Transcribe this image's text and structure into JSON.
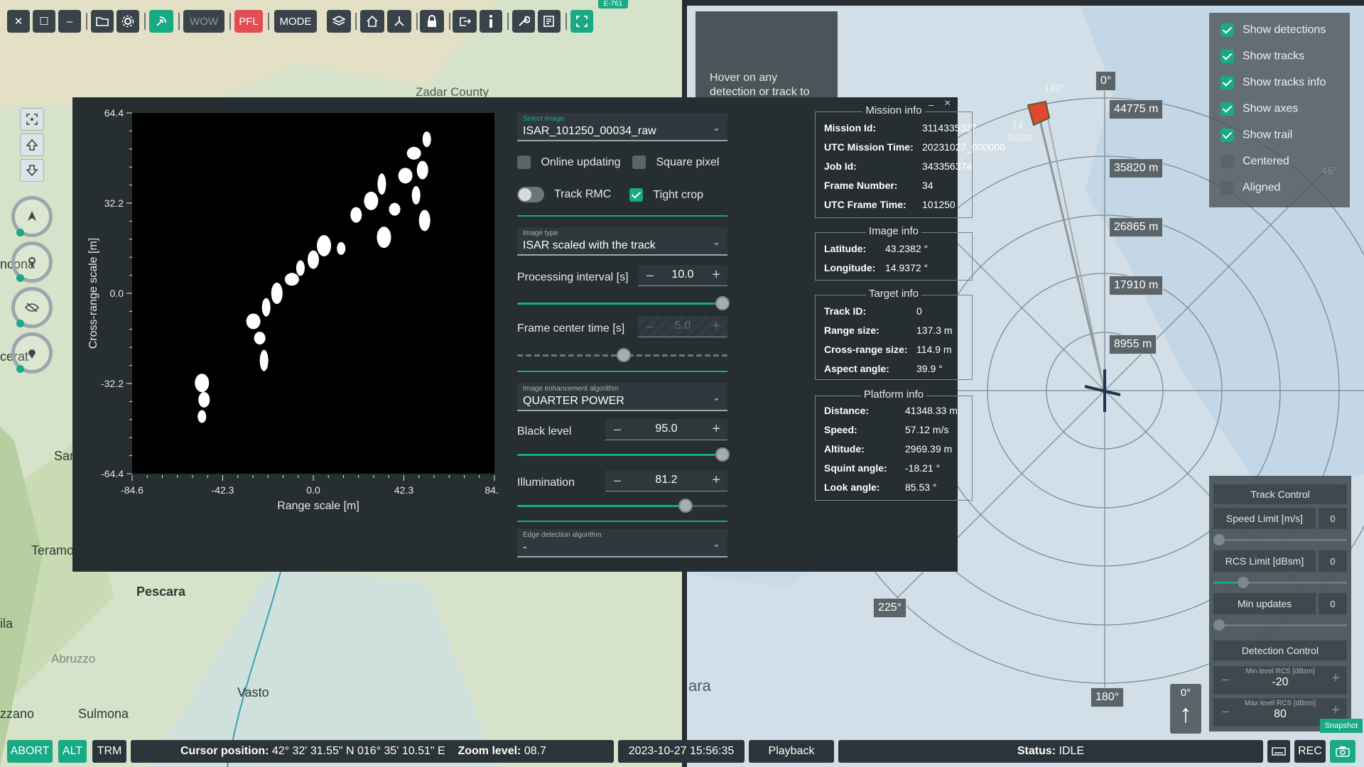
{
  "toolbar": {
    "close": "✕",
    "maximize": "☐",
    "minimize": "–",
    "wow_label": "WOW",
    "pfl_label": "PFL",
    "mode_label": "MODE",
    "map_badge": "E-761"
  },
  "map_left": {
    "labels": [
      "Zadar County",
      "ncona",
      "cerat",
      "Sar",
      "Teramo",
      "Pescara",
      "ila",
      "Abruzzo",
      "Vasto",
      "zzano",
      "Sulmona"
    ]
  },
  "image_panel": {
    "y_axis_label": "Cross-range scale [m]",
    "x_axis_label": "Range scale [m]",
    "y_ticks": [
      "64.4",
      "32.2",
      "0.0",
      "-32.2",
      "-64.4"
    ],
    "x_ticks": [
      "-84.6",
      "-42.3",
      "0.0",
      "42.3",
      "84.6"
    ]
  },
  "controls": {
    "select_image_label": "Select image",
    "select_image_value": "ISAR_101250_00034_raw",
    "online_updating": "Online updating",
    "square_pixel": "Square pixel",
    "track_rmc": "Track RMC",
    "tight_crop": "Tight crop",
    "image_type_label": "Image type",
    "image_type_value": "ISAR scaled with the track",
    "processing_interval_label": "Processing interval [s]",
    "processing_interval_value": "10.0",
    "frame_center_label": "Frame center time [s]",
    "frame_center_value": "5.0",
    "enhancement_label": "Image enhancement algorithm",
    "enhancement_value": "QUARTER POWER",
    "black_level_label": "Black level",
    "black_level_value": "95.0",
    "illumination_label": "Illumination",
    "illumination_value": "81.2",
    "edge_label": "Edge detection algorithm",
    "edge_value": "-",
    "minus": "–",
    "plus": "+",
    "chevron": "⌄",
    "panel_minimize": "–",
    "panel_close": "×"
  },
  "mission_info": {
    "title": "Mission info",
    "rows": [
      {
        "k": "Mission Id:",
        "v": "3114335327"
      },
      {
        "k": "UTC Mission Time:",
        "v": "20231027_000000"
      },
      {
        "k": "Job Id:",
        "v": "343356374"
      },
      {
        "k": "Frame Number:",
        "v": "34"
      },
      {
        "k": "UTC Frame Time:",
        "v": "101250"
      }
    ]
  },
  "image_info": {
    "title": "Image info",
    "rows": [
      {
        "k": "Latitude:",
        "v": "43.2382 °"
      },
      {
        "k": "Longitude:",
        "v": "14.9372 °"
      }
    ]
  },
  "target_info": {
    "title": "Target info",
    "rows": [
      {
        "k": "Track ID:",
        "v": "0"
      },
      {
        "k": "Range size:",
        "v": "137.3 m"
      },
      {
        "k": "Cross-range size:",
        "v": "114.9 m"
      },
      {
        "k": "Aspect angle:",
        "v": "39.9 °"
      }
    ]
  },
  "platform_info": {
    "title": "Platform info",
    "rows": [
      {
        "k": "Distance:",
        "v": "41348.33 m"
      },
      {
        "k": "Speed:",
        "v": "57.12 m/s"
      },
      {
        "k": "Altitude:",
        "v": "2969.39 m"
      },
      {
        "k": "Squint angle:",
        "v": "-18.21 °"
      },
      {
        "k": "Look angle:",
        "v": "85.53 °"
      }
    ]
  },
  "hover_box": {
    "text1": "Hover on any",
    "text2": "detection or track to"
  },
  "overlay_options": {
    "items": [
      {
        "label": "Show detections",
        "checked": true
      },
      {
        "label": "Show tracks",
        "checked": true
      },
      {
        "label": "Show tracks info",
        "checked": true
      },
      {
        "label": "Show axes",
        "checked": true
      },
      {
        "label": "Show trail",
        "checked": true
      },
      {
        "label": "Centered",
        "checked": false
      },
      {
        "label": "Aligned",
        "checked": false
      }
    ],
    "faint_angle": "45°"
  },
  "radar": {
    "ranges": [
      "44775 m",
      "35820 m",
      "26865 m",
      "17910 m",
      "8955 m"
    ],
    "angles": {
      "top": "0°",
      "bottom": "180°",
      "left": "225°",
      "track": "140°"
    },
    "track_label_1": "14",
    "track_label_2": "R026",
    "map_text": "ara",
    "north_label": "0°",
    "north_arrow": "↑"
  },
  "track_control": {
    "title": "Track Control",
    "speed_limit_label": "Speed Limit [m/s]",
    "speed_limit_value": "0",
    "rcs_limit_label": "RCS Limit [dBsm]",
    "rcs_limit_value": "0",
    "min_updates_label": "Min updates",
    "min_updates_value": "0",
    "detection_title": "Detection Control",
    "min_rcs_label": "Min level RCS [dBsm]",
    "min_rcs_value": "-20",
    "max_rcs_label": "Max level RCS [dBsm]",
    "max_rcs_value": "80",
    "snapshot": "Snapshot"
  },
  "statusbar": {
    "abort": "ABORT",
    "alt": "ALT",
    "trm": "TRM",
    "cursor_label": "Cursor position:",
    "cursor_value": "42° 32' 31.55\" N 016° 35' 10.51\" E",
    "zoom_label": "Zoom level:",
    "zoom_value": "08.7",
    "datetime": "2023-10-27 15:56:35",
    "playback": "Playback",
    "status_label": "Status:",
    "status_value": "IDLE",
    "rec": "REC"
  },
  "chart_data": {
    "type": "heatmap",
    "xlabel": "Range scale [m]",
    "ylabel": "Cross-range scale [m]",
    "xlim": [
      -84.6,
      84.6
    ],
    "ylim": [
      -64.4,
      64.4
    ],
    "x_ticks": [
      -84.6,
      -42.3,
      0.0,
      42.3,
      84.6
    ],
    "y_ticks": [
      64.4,
      32.2,
      0.0,
      -32.2,
      -64.4
    ],
    "scatterers": [
      {
        "x": -52,
        "y": -44
      },
      {
        "x": -51,
        "y": -38
      },
      {
        "x": -52,
        "y": -32
      },
      {
        "x": -23,
        "y": -24
      },
      {
        "x": -25,
        "y": -16
      },
      {
        "x": -28,
        "y": -10
      },
      {
        "x": -22,
        "y": -5
      },
      {
        "x": -17,
        "y": 0
      },
      {
        "x": -10,
        "y": 5
      },
      {
        "x": -6,
        "y": 9
      },
      {
        "x": 0,
        "y": 12
      },
      {
        "x": 5,
        "y": 17
      },
      {
        "x": 13,
        "y": 16
      },
      {
        "x": 20,
        "y": 28
      },
      {
        "x": 27,
        "y": 33
      },
      {
        "x": 32,
        "y": 39
      },
      {
        "x": 38,
        "y": 30
      },
      {
        "x": 43,
        "y": 42
      },
      {
        "x": 48,
        "y": 35
      },
      {
        "x": 52,
        "y": 26
      },
      {
        "x": 47,
        "y": 50
      },
      {
        "x": 53,
        "y": 55
      },
      {
        "x": 51,
        "y": 44
      },
      {
        "x": 33,
        "y": 20
      }
    ]
  }
}
